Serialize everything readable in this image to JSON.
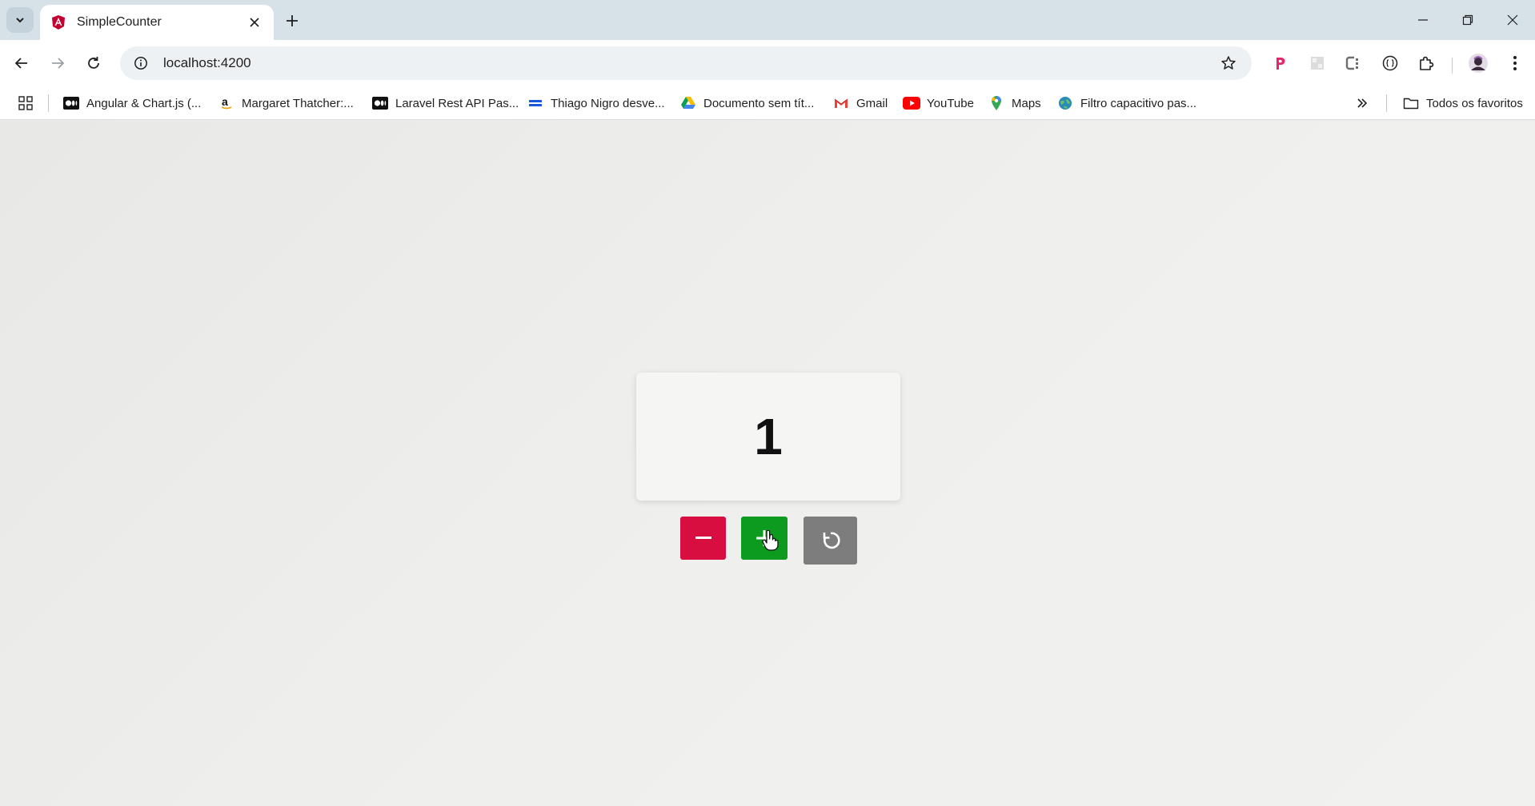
{
  "browser": {
    "tab": {
      "title": "SimpleCounter",
      "favicon": "angular-icon"
    },
    "address_bar": {
      "url": "localhost:4200"
    },
    "bookmarks": [
      {
        "label": "Angular & Chart.js (...",
        "icon": "medium-icon"
      },
      {
        "label": "Margaret Thatcher:...",
        "icon": "amazon-icon"
      },
      {
        "label": "Laravel Rest API Pas...",
        "icon": "medium-icon"
      },
      {
        "label": "Thiago Nigro desve...",
        "icon": "bookmark-stripes-icon"
      },
      {
        "label": "Documento sem tít...",
        "icon": "drive-icon"
      },
      {
        "label": "Gmail",
        "icon": "gmail-icon"
      },
      {
        "label": "YouTube",
        "icon": "youtube-icon"
      },
      {
        "label": "Maps",
        "icon": "maps-icon"
      },
      {
        "label": "Filtro capacitivo pas...",
        "icon": "globe-icon"
      }
    ],
    "all_bookmarks_label": "Todos os favoritos"
  },
  "counter": {
    "value": "1",
    "colors": {
      "decrement": "#d80e41",
      "increment": "#0c9a1f",
      "reset": "#7d7d7d"
    }
  },
  "colors": {
    "tabstrip": "#d6e1e8",
    "toolbar": "#ffffff",
    "omnibox": "#eef1f4",
    "page_background": "#ececec"
  }
}
